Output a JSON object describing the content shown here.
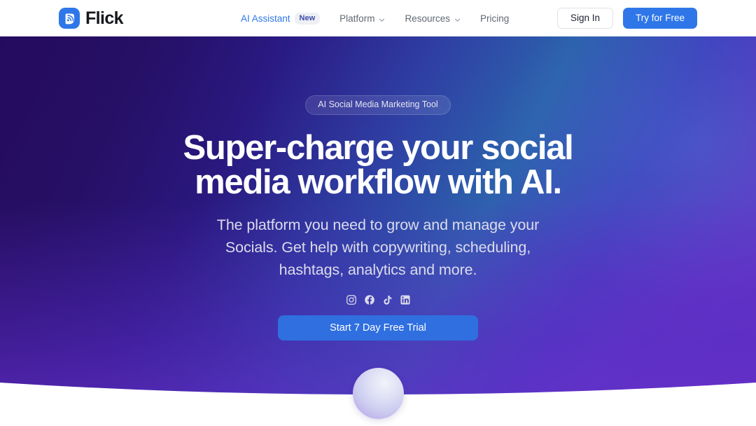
{
  "header": {
    "brand": {
      "name": "Flick",
      "icon": "flick-logo-icon",
      "color": "#2f77e8"
    },
    "nav": [
      {
        "label": "AI Assistant",
        "active": true,
        "badge": "New",
        "caret": false
      },
      {
        "label": "Platform",
        "active": false,
        "badge": null,
        "caret": true
      },
      {
        "label": "Resources",
        "active": false,
        "badge": null,
        "caret": true
      },
      {
        "label": "Pricing",
        "active": false,
        "badge": null,
        "caret": false
      }
    ],
    "sign_in_label": "Sign In",
    "try_free_label": "Try for Free"
  },
  "hero": {
    "pill_label": "AI Social Media Marketing Tool",
    "headline_line_1": "Super-charge your social",
    "headline_line_2": "media workflow with AI.",
    "subheading": "The platform you need to grow and manage your Socials. Get help with copywriting, scheduling, hashtags, analytics and more.",
    "cta_label": "Start 7 Day Free Trial",
    "socials": [
      {
        "name": "instagram-icon",
        "label": "Instagram"
      },
      {
        "name": "facebook-icon",
        "label": "Facebook"
      },
      {
        "name": "tiktok-icon",
        "label": "TikTok"
      },
      {
        "name": "linkedin-icon",
        "label": "LinkedIn"
      }
    ],
    "colors": {
      "gradient_start": "#220a5e",
      "gradient_mid_blue": "#2c62ad",
      "gradient_end": "#6a33c9",
      "accent_button": "#2f6fe0",
      "pill_text": "#e3e4f3",
      "sphere_light": "#f2f3fb",
      "sphere_dark": "#b1a6e6"
    }
  }
}
